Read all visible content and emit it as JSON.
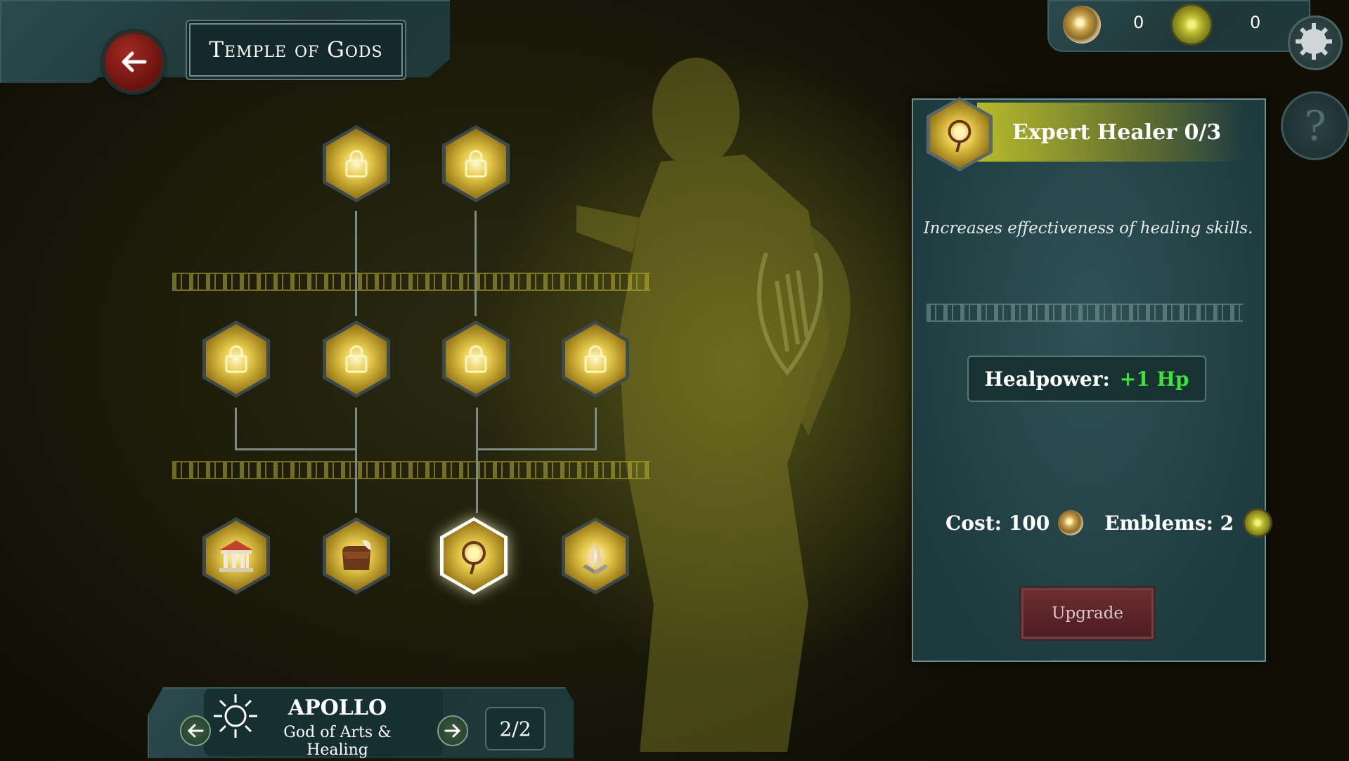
{
  "header": {
    "title": "Temple of Gods"
  },
  "currency": {
    "coins": "0",
    "emblems": "0"
  },
  "help": {
    "label": "?"
  },
  "skill_tree": {
    "top_row": [
      "locked-skill",
      "locked-skill"
    ],
    "middle_row": [
      "locked-skill",
      "locked-skill",
      "locked-skill",
      "locked-skill"
    ],
    "bottom_row": [
      "temple-icon",
      "satchel-icon",
      "sun-staff-icon",
      "praying-hands-icon"
    ],
    "selected": "sun-staff-icon"
  },
  "info": {
    "title": "Expert Healer 0/3",
    "description": "Increases effectiveness of healing skills.",
    "stat_label": "Healpower:",
    "stat_value": "+1 Hp",
    "cost_label": "Cost: 100",
    "emblems_label": "Emblems: 2",
    "upgrade_label": "Upgrade"
  },
  "god": {
    "name": "APOLLO",
    "subtitle": "God of Arts & Healing",
    "page": "2/2"
  },
  "colors": {
    "accent_green": "#3fe23a",
    "panel_teal": "#1d3a3d",
    "button_red": "#6e2e32",
    "gold": "#e5c84a"
  }
}
